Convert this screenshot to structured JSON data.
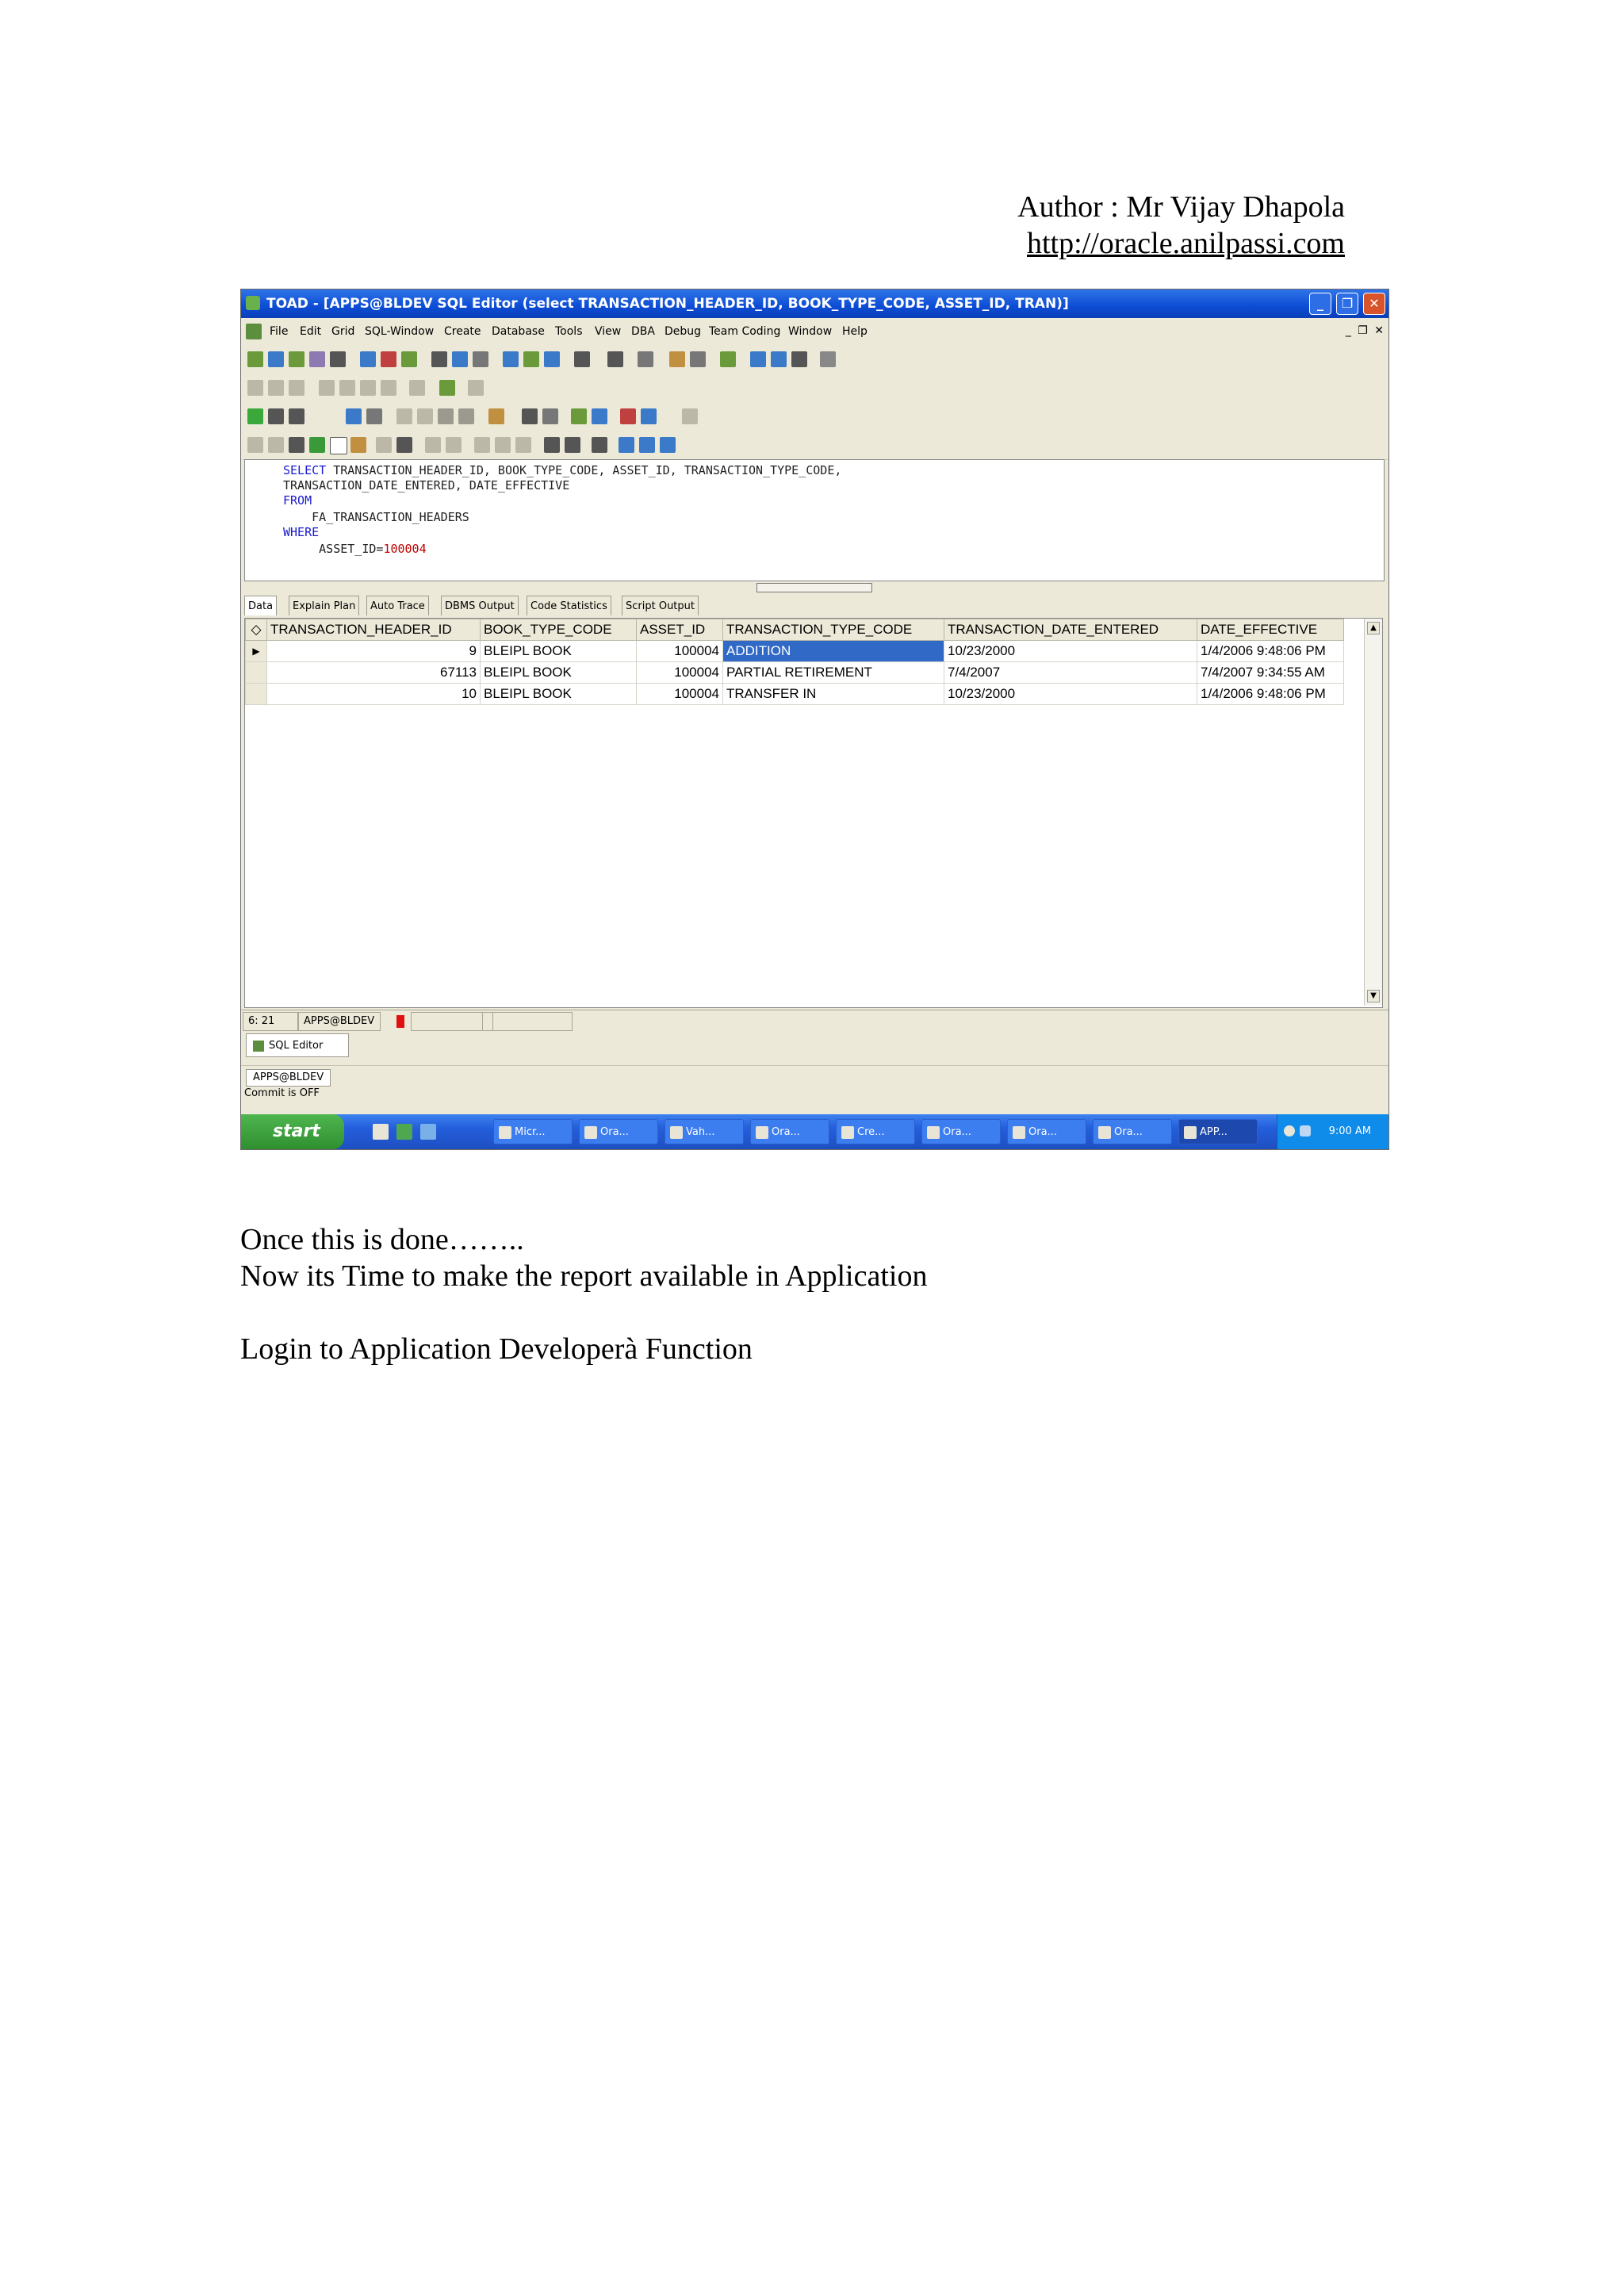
{
  "header": {
    "author": "Author : Mr Vijay Dhapola",
    "url": "http://oracle.anilpassi.com"
  },
  "window": {
    "title": "TOAD - [APPS@BLDEV SQL Editor (select TRANSACTION_HEADER_ID, BOOK_TYPE_CODE, ASSET_ID, TRAN)]",
    "menu": [
      "File",
      "Edit",
      "Grid",
      "SQL-Window",
      "Create",
      "Database",
      "Tools",
      "View",
      "DBA",
      "Debug",
      "Team Coding",
      "Window",
      "Help"
    ]
  },
  "editor": {
    "line1_kw": "SELECT",
    "line1_rest": " TRANSACTION_HEADER_ID, BOOK_TYPE_CODE, ASSET_ID, TRANSACTION_TYPE_CODE,",
    "line2": "TRANSACTION_DATE_ENTERED, DATE_EFFECTIVE",
    "line3_kw": "FROM",
    "line4": "    FA_TRANSACTION_HEADERS",
    "line5_kw": "WHERE",
    "line6_prefix": "     ASSET_ID=",
    "line6_value": "100004"
  },
  "tabs": [
    "Data",
    "Explain Plan",
    "Auto Trace",
    "DBMS Output",
    "Code Statistics",
    "Script Output"
  ],
  "grid": {
    "columns": [
      "TRANSACTION_HEADER_ID",
      "BOOK_TYPE_CODE",
      "ASSET_ID",
      "TRANSACTION_TYPE_CODE",
      "TRANSACTION_DATE_ENTERED",
      "DATE_EFFECTIVE"
    ],
    "rows": [
      [
        "9",
        "BLEIPL BOOK",
        "100004",
        "ADDITION",
        "10/23/2000",
        "1/4/2006 9:48:06 PM"
      ],
      [
        "67113",
        "BLEIPL BOOK",
        "100004",
        "PARTIAL RETIREMENT",
        "7/4/2007",
        "7/4/2007 9:34:55 AM"
      ],
      [
        "10",
        "BLEIPL BOOK",
        "100004",
        "TRANSFER IN",
        "10/23/2000",
        "1/4/2006 9:48:06 PM"
      ]
    ]
  },
  "status": {
    "position": "6: 21",
    "connection": "APPS@BLDEV",
    "window_tab": "SQL Editor",
    "conn_label": "APPS@BLDEV",
    "commit": "Commit is OFF"
  },
  "taskbar": {
    "start": "start",
    "tasks": [
      "Micr...",
      "Ora...",
      "Vah...",
      "Ora...",
      "Cre...",
      "Ora...",
      "Ora...",
      "Ora...",
      "APP..."
    ],
    "clock": "9:00 AM"
  },
  "body": {
    "line1": "Once this is done……..",
    "line2": "Now its Time to make the report available  in Application",
    "line3": "Login to Application Developerà Function"
  },
  "colors": {
    "titlebar": "#0c4cd4",
    "selection": "#3169c6",
    "taskbar": "#245edb",
    "keyword": "#1a1ad0"
  }
}
